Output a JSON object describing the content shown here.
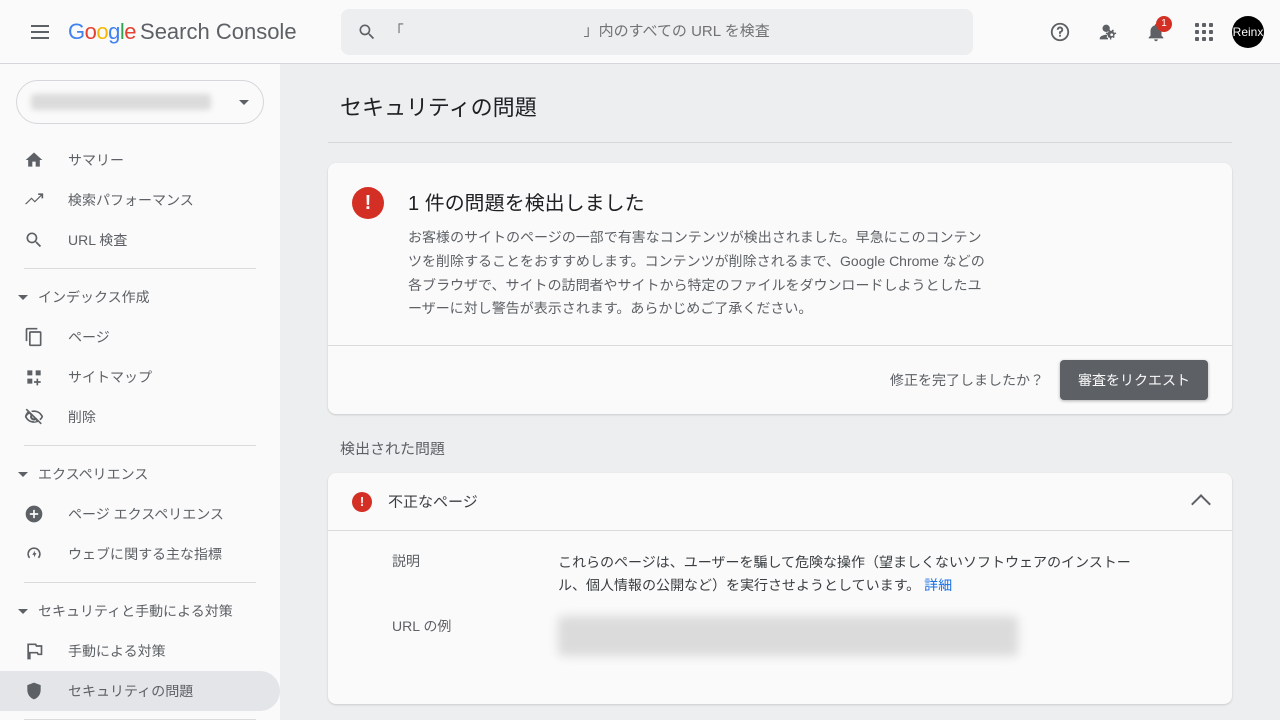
{
  "header": {
    "logo_text": "Search Console",
    "search_placeholder": "「　　　　　　　　　　　　」内のすべての URL を検査",
    "notification_count": "1",
    "avatar_initials": "Reinx"
  },
  "sidebar": {
    "items": [
      {
        "label": "サマリー"
      },
      {
        "label": "検索パフォーマンス"
      },
      {
        "label": "URL 検査"
      }
    ],
    "sections": [
      {
        "title": "インデックス作成",
        "items": [
          {
            "label": "ページ"
          },
          {
            "label": "サイトマップ"
          },
          {
            "label": "削除"
          }
        ]
      },
      {
        "title": "エクスペリエンス",
        "items": [
          {
            "label": "ページ エクスペリエンス"
          },
          {
            "label": "ウェブに関する主な指標"
          }
        ]
      },
      {
        "title": "セキュリティと手動による対策",
        "items": [
          {
            "label": "手動による対策"
          },
          {
            "label": "セキュリティの問題"
          }
        ]
      }
    ]
  },
  "main": {
    "page_title": "セキュリティの問題",
    "alert": {
      "title": "1 件の問題を検出しました",
      "body": "お客様のサイトのページの一部で有害なコンテンツが検出されました。早急にこのコンテンツを削除することをおすすめします。コンテンツが削除されるまで、Google Chrome などの各ブラウザで、サイトの訪問者やサイトから特定のファイルをダウンロードしようとしたユーザーに対し警告が表示されます。あらかじめご了承ください。",
      "action_text": "修正を完了しましたか？",
      "button": "審査をリクエスト"
    },
    "detected_section_title": "検出された問題",
    "issue": {
      "title": "不正なページ",
      "desc_label": "説明",
      "desc_value": "これらのページは、ユーザーを騙して危険な操作（望ましくないソフトウェアのインストール、個人情報の公開など）を実行させようとしています。",
      "desc_link": "詳細",
      "url_label": "URL の例"
    }
  }
}
